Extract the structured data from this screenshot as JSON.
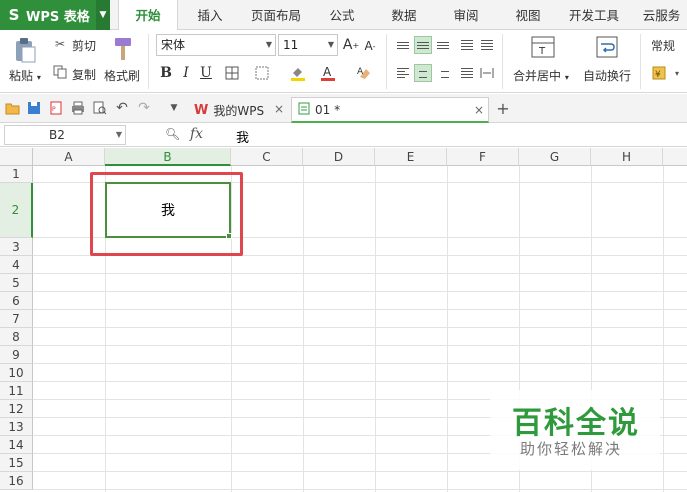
{
  "app": {
    "brand": "WPS 表格",
    "brand_logo": "S"
  },
  "menu_tabs": [
    "开始",
    "插入",
    "页面布局",
    "公式",
    "数据",
    "审阅",
    "视图",
    "开发工具",
    "云服务"
  ],
  "active_tab": "开始",
  "ribbon": {
    "paste": "粘贴",
    "cut": "剪切",
    "copy": "复制",
    "format_painter": "格式刷",
    "font_name": "宋体",
    "font_size": "11",
    "merge_center": "合并居中",
    "wrap_text": "自动换行",
    "number_format": "常规"
  },
  "doc_tabs": [
    {
      "label": "我的WPS",
      "icon": "wps-w-icon"
    },
    {
      "label": "01 *",
      "icon": "sheet-doc-icon"
    }
  ],
  "formula_bar": {
    "name_box": "B2",
    "fx": "fx",
    "content": "我"
  },
  "columns": [
    "A",
    "B",
    "C",
    "D",
    "E",
    "F",
    "G",
    "H"
  ],
  "selected_column": "B",
  "rows": [
    "1",
    "2",
    "3",
    "4",
    "5",
    "6",
    "7",
    "8",
    "9",
    "10",
    "11",
    "12",
    "13",
    "14",
    "15",
    "16"
  ],
  "selected_row": "2",
  "cells": {
    "B2": "我"
  },
  "watermark": {
    "title": "百科全说",
    "subtitle": "助你轻松解决"
  },
  "colors": {
    "brand": "#2f8f3a",
    "selection": "#4a8f3c",
    "highlight_box": "#e0464e",
    "watermark": "#2e9a3c"
  }
}
